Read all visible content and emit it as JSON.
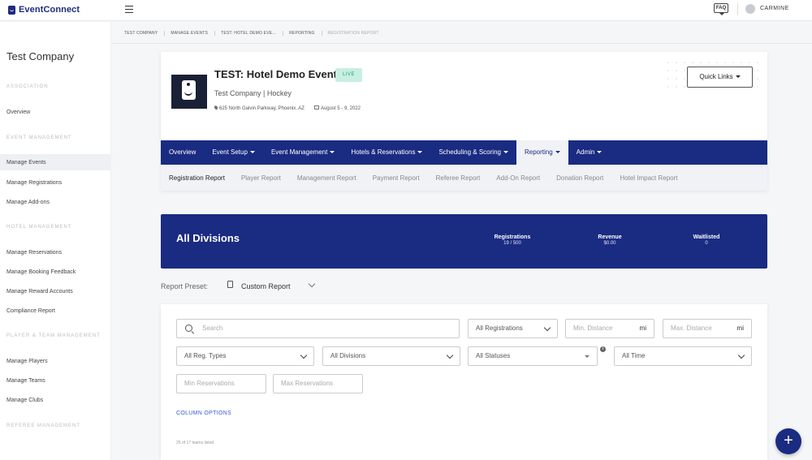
{
  "topbar": {
    "logo_text": "EventConnect",
    "faq_label": "FAQ",
    "user_name": "CARMINE"
  },
  "sidebar": {
    "company": "Test Company",
    "sections": {
      "association": "ASSOCIATION",
      "event_management": "EVENT MANAGEMENT",
      "hotel_management": "HOTEL MANAGEMENT",
      "player_team_management": "PLAYER & TEAM MANAGEMENT",
      "referee_management": "REFEREE MANAGEMENT"
    },
    "items": {
      "overview": "Overview",
      "manage_events": "Manage Events",
      "manage_registrations": "Manage Registrations",
      "manage_addons": "Manage Add-ons",
      "manage_reservations": "Manage Reservations",
      "manage_booking_feedback": "Manage Booking Feedback",
      "manage_reward_accounts": "Manage Reward Accounts",
      "compliance_report": "Compliance Report",
      "manage_players": "Manage Players",
      "manage_teams": "Manage Teams",
      "manage_clubs": "Manage Clubs"
    }
  },
  "breadcrumb": [
    "TEST COMPANY",
    "MANAGE EVENTS",
    "TEST: HOTEL DEMO EVE...",
    "REPORTING",
    "REGISTRATION REPORT"
  ],
  "event": {
    "title": "TEST: Hotel Demo Event",
    "status": "LIVE",
    "subtitle": "Test Company | Hockey",
    "address": "625 North Galvin Parkway, Phoenix, AZ",
    "dates": "August 5 - 9, 2022",
    "quick_links": "Quick Links"
  },
  "main_nav": [
    "Overview",
    "Event Setup",
    "Event Management",
    "Hotels & Reservations",
    "Scheduling & Scoring",
    "Reporting",
    "Admin"
  ],
  "sub_nav": [
    "Registration Report",
    "Player Report",
    "Management Report",
    "Payment Report",
    "Referee Report",
    "Add-On Report",
    "Donation Report",
    "Hotel Impact Report"
  ],
  "banner": {
    "title": "All Divisions",
    "stats": [
      {
        "label": "Registrations",
        "value": "19 / 500"
      },
      {
        "label": "Revenue",
        "value": "$0.00"
      },
      {
        "label": "Waitlisted",
        "value": "0"
      }
    ]
  },
  "preset": {
    "label": "Report Preset:",
    "value": "Custom Report"
  },
  "filters": {
    "search_placeholder": "Search",
    "registrations": "All Registrations",
    "min_distance": "Min. Distance",
    "max_distance": "Max. Distance",
    "distance_unit": "mi",
    "reg_types": "All Reg. Types",
    "divisions": "All Divisions",
    "statuses": "All Statuses",
    "time": "All Time",
    "min_reservations": "Min Reservations",
    "max_reservations": "Max Reservations",
    "column_options": "COLUMN OPTIONS",
    "count_text": "25 of 17 teams listed"
  },
  "fab_label": "+"
}
